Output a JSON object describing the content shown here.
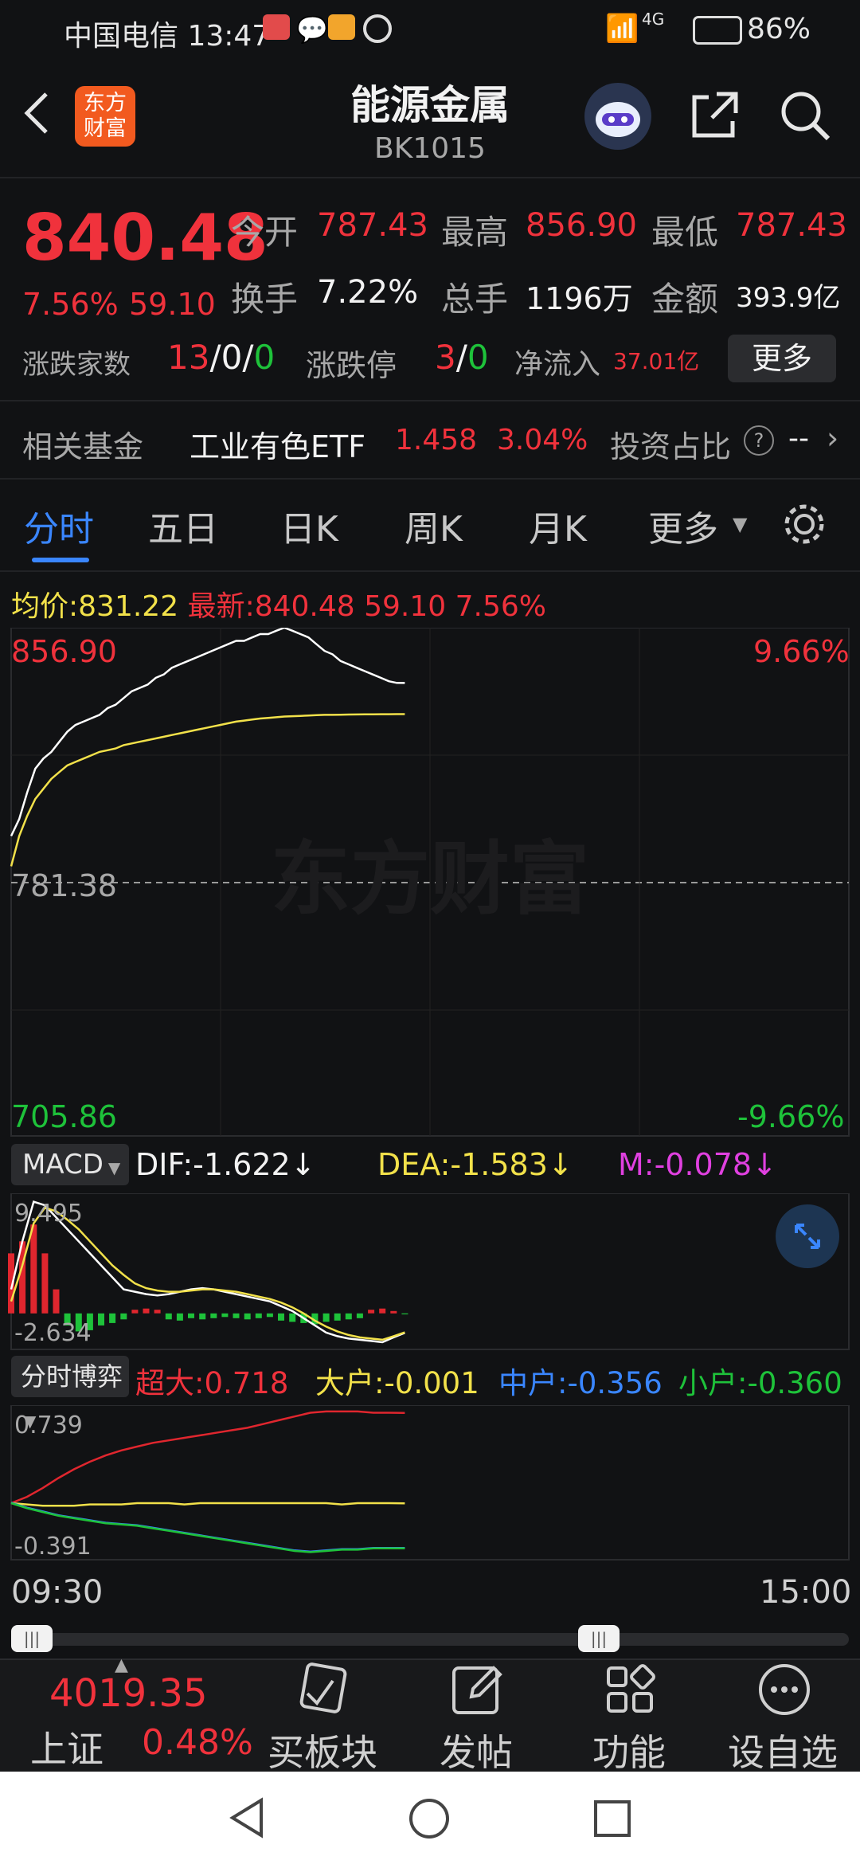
{
  "status_bar": {
    "carrier_time": "中国电信 13:47",
    "network": "4G",
    "battery": "86%"
  },
  "header": {
    "logo_line1": "东方",
    "logo_line2": "财富",
    "title": "能源金属",
    "code": "BK1015"
  },
  "quote": {
    "price": "840.48",
    "change_pct": "7.56%",
    "change_amt": "59.10",
    "open_label": "今开",
    "open": "787.43",
    "high_label": "最高",
    "high": "856.90",
    "low_label": "最低",
    "low": "787.43",
    "turnover_label": "换手",
    "turnover": "7.22%",
    "volume_label": "总手",
    "volume": "1196万",
    "amount_label": "金额",
    "amount": "393.9亿",
    "breadth_label": "涨跌家数",
    "breadth_up": "13",
    "breadth_flat": "0",
    "breadth_down": "0",
    "limit_label": "涨跌停",
    "limit_up": "3",
    "limit_down": "0",
    "netflow_label": "净流入",
    "netflow": "37.01亿",
    "more_button": "更多"
  },
  "fund": {
    "label": "相关基金",
    "name": "工业有色ETF",
    "price": "1.458",
    "pct": "3.04%",
    "ratio_label": "投资占比",
    "ratio_value": "--"
  },
  "tabs": [
    "分时",
    "五日",
    "日K",
    "周K",
    "月K",
    "更多"
  ],
  "info_line": {
    "avg_label": "均价:",
    "avg": "831.22",
    "latest_label": "最新:",
    "latest": "840.48",
    "chg": "59.10",
    "pct": "7.56%"
  },
  "price_chart": {
    "top_value": "856.90",
    "top_pct": "9.66%",
    "mid_value": "781.38",
    "bottom_value": "705.86",
    "bottom_pct": "-9.66%",
    "watermark": "东方财富"
  },
  "macd": {
    "selector": "MACD",
    "dif": "DIF:-1.622↓",
    "dea": "DEA:-1.583↓",
    "m": "M:-0.078↓",
    "top": "9.495",
    "bottom": "-2.634"
  },
  "flow": {
    "selector": "分时博弈",
    "super_large": "超大:0.718",
    "large": "大户:-0.001",
    "medium": "中户:-0.356",
    "small": "小户:-0.360",
    "top": "0.739",
    "bottom": "-0.391"
  },
  "time_axis": {
    "start": "09:30",
    "end": "15:00"
  },
  "bottom_nav": {
    "index_value": "4019.35",
    "index_name": "上证",
    "index_pct": "0.48%",
    "items": [
      "买板块",
      "发帖",
      "功能",
      "设自选"
    ]
  },
  "chart_data": {
    "type": "line",
    "x_range": [
      "09:30",
      "15:00"
    ],
    "ylim": [
      705.86,
      856.9
    ],
    "prev_close": 781.38,
    "series": [
      {
        "name": "最新",
        "color": "#ffffff",
        "values": [
          795,
          800,
          808,
          815,
          818,
          820,
          823,
          826,
          828,
          829,
          830,
          831,
          833,
          834,
          836,
          838,
          839,
          840,
          842,
          843,
          845,
          846,
          847,
          848,
          849,
          850,
          851,
          852,
          853,
          853,
          854,
          855,
          855,
          856,
          856.9,
          856,
          855,
          854,
          852,
          850,
          849,
          847,
          846,
          845,
          844,
          843,
          842,
          841,
          840.5,
          840.48
        ]
      },
      {
        "name": "均价",
        "color": "#f2e14a",
        "values": [
          786,
          795,
          801,
          806,
          809,
          812,
          814,
          816,
          817,
          818,
          819,
          820,
          820.5,
          821,
          822,
          822.5,
          823,
          823.5,
          824,
          824.5,
          825,
          825.5,
          826,
          826.5,
          827,
          827.5,
          828,
          828.5,
          829,
          829.3,
          829.6,
          829.9,
          830.1,
          830.3,
          830.5,
          830.6,
          830.7,
          830.8,
          830.9,
          831,
          831,
          831.05,
          831.1,
          831.12,
          831.15,
          831.17,
          831.19,
          831.2,
          831.21,
          831.22
        ]
      }
    ],
    "macd": {
      "dif": [
        2,
        6,
        9.3,
        9,
        8,
        7,
        6,
        5,
        4,
        3,
        2,
        1.8,
        1.6,
        1.5,
        1.6,
        1.8,
        2,
        2.1,
        2,
        1.8,
        1.6,
        1.4,
        1.2,
        1,
        0.6,
        0.2,
        -0.4,
        -1,
        -1.6,
        -1.9,
        -2.1,
        -2.2,
        -2.3,
        -2.4,
        -2,
        -1.622
      ],
      "dea": [
        1,
        4,
        7.5,
        8.8,
        8.5,
        7.8,
        7,
        6,
        5,
        4,
        3.2,
        2.5,
        2.1,
        1.9,
        1.8,
        1.8,
        1.9,
        2,
        2,
        1.9,
        1.8,
        1.6,
        1.4,
        1.2,
        0.9,
        0.5,
        0,
        -0.6,
        -1.1,
        -1.5,
        -1.8,
        -2,
        -2.1,
        -2.2,
        -1.9,
        -1.583
      ],
      "hist": [
        5,
        6,
        7.4,
        5,
        2,
        -1,
        -1.5,
        -1.4,
        -1,
        -0.8,
        -0.5,
        0.3,
        0.4,
        0.3,
        -0.5,
        -0.6,
        -0.4,
        -0.5,
        -0.4,
        -0.3,
        -0.4,
        -0.5,
        -0.4,
        -0.3,
        -0.6,
        -0.7,
        -0.8,
        -0.9,
        -0.7,
        -0.6,
        -0.5,
        -0.4,
        0.3,
        0.4,
        0.2,
        -0.078
      ]
    },
    "flow": {
      "super_large": [
        0,
        0.05,
        0.12,
        0.2,
        0.27,
        0.33,
        0.38,
        0.42,
        0.45,
        0.48,
        0.5,
        0.52,
        0.54,
        0.56,
        0.58,
        0.6,
        0.63,
        0.66,
        0.69,
        0.72,
        0.73,
        0.73,
        0.73,
        0.72,
        0.72,
        0.718
      ],
      "large": [
        0,
        -0.01,
        -0.02,
        -0.02,
        -0.02,
        -0.01,
        -0.01,
        -0.01,
        0,
        0,
        0,
        -0.01,
        0,
        0,
        0,
        0,
        0,
        0,
        0,
        0,
        0,
        -0.01,
        0,
        0,
        0,
        -0.001
      ],
      "small": [
        0,
        -0.04,
        -0.07,
        -0.1,
        -0.12,
        -0.14,
        -0.16,
        -0.17,
        -0.18,
        -0.2,
        -0.22,
        -0.24,
        -0.26,
        -0.28,
        -0.3,
        -0.32,
        -0.34,
        -0.36,
        -0.38,
        -0.39,
        -0.38,
        -0.37,
        -0.37,
        -0.36,
        -0.36,
        -0.36
      ]
    }
  }
}
